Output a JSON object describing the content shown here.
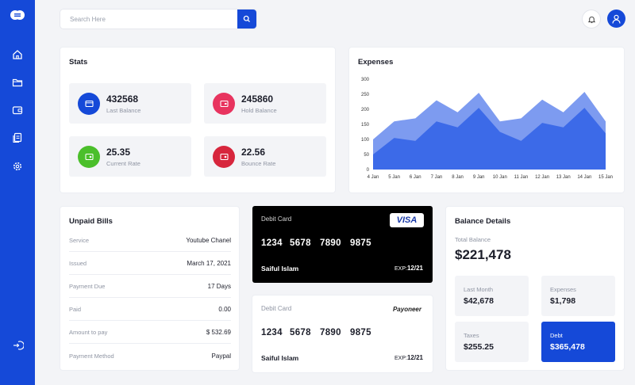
{
  "search": {
    "placeholder": "Search Here"
  },
  "stats": {
    "title": "Stats",
    "items": [
      {
        "value": "432568",
        "label": "Last Balance",
        "color": "#1549d8"
      },
      {
        "value": "245860",
        "label": "Hold Balance",
        "color": "#e8345f"
      },
      {
        "value": "25.35",
        "label": "Current Rate",
        "color": "#4bbf2b"
      },
      {
        "value": "22.56",
        "label": "Bounce Rate",
        "color": "#d7263d"
      }
    ]
  },
  "expenses": {
    "title": "Expenses"
  },
  "chart_data": {
    "type": "area",
    "x": [
      "4 Jan",
      "5 Jan",
      "6 Jan",
      "7 Jan",
      "8 Jan",
      "9 Jan",
      "10 Jan",
      "11 Jan",
      "12 Jan",
      "13 Jan",
      "14 Jan",
      "15 Jan"
    ],
    "yticks": [
      0,
      50,
      100,
      150,
      200,
      250,
      300
    ],
    "ylim": [
      0,
      300
    ],
    "grid": false,
    "series": [
      {
        "values": [
          100,
          160,
          170,
          230,
          190,
          255,
          160,
          170,
          232,
          190,
          258,
          160
        ],
        "color": "#7d9bf0"
      },
      {
        "values": [
          50,
          105,
          95,
          160,
          140,
          205,
          125,
          95,
          155,
          140,
          205,
          120
        ],
        "color": "#3c6ae8"
      }
    ]
  },
  "bills": {
    "title": "Unpaid Bills",
    "rows": [
      {
        "key": "Service",
        "value": "Youtube Chanel"
      },
      {
        "key": "Issued",
        "value": "March 17, 2021"
      },
      {
        "key": "Payment Due",
        "value": "17 Days"
      },
      {
        "key": "Paid",
        "value": "0.00"
      },
      {
        "key": "Amount to pay",
        "value": "$ 532.69"
      },
      {
        "key": "Payment Method",
        "value": "Paypal"
      }
    ]
  },
  "cards": [
    {
      "label": "Debit Card",
      "brand": "VISA",
      "groups": [
        "1234",
        "5678",
        "7890",
        "9875"
      ],
      "holder": "Saiful Islam",
      "exp_label": "EXP:",
      "exp": "12/21"
    },
    {
      "label": "Debit Card",
      "brand": "Payoneer",
      "groups": [
        "1234",
        "5678",
        "7890",
        "9875"
      ],
      "holder": "Saiful Islam",
      "exp_label": "EXP:",
      "exp": "12/21"
    }
  ],
  "balance": {
    "title": "Balance Details",
    "total_label": "Total Balance",
    "total": "$221,478",
    "boxes": [
      {
        "label": "Last Month",
        "value": "$42,678"
      },
      {
        "label": "Expenses",
        "value": "$1,798"
      },
      {
        "label": "Taxes",
        "value": "$255.25"
      },
      {
        "label": "Debt",
        "value": "$365,478"
      }
    ]
  },
  "colors": {
    "primary": "#1549d8",
    "background": "#f3f4f7"
  }
}
